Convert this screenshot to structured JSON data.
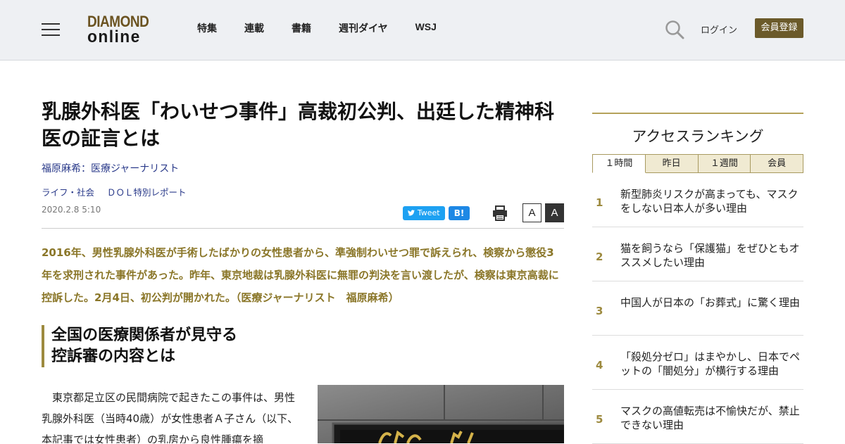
{
  "header": {
    "logo_top": "DIAMOND",
    "logo_bottom": "online",
    "nav": [
      "特集",
      "連載",
      "書籍",
      "週刊ダイヤ",
      "WSJ"
    ],
    "login_label": "ログイン",
    "register_label": "会員登録"
  },
  "article": {
    "title": "乳腺外科医「わいせつ事件」高裁初公判、出廷した精神科医の証言とは",
    "author": "福原麻希：医療ジャーナリスト",
    "categories": [
      "ライフ・社会",
      "ＤＯＬ特別レポート"
    ],
    "date": "2020.2.8 5:10",
    "tweet_label": "Tweet",
    "hatena_label": "B!",
    "font_small": "A",
    "font_large": "A",
    "lead": "2016年、男性乳腺外科医が手術したばかりの女性患者から、準強制わいせつ罪で訴えられ、検察から懲役3年を求刑された事件があった。昨年、東京地裁は乳腺外科医に無罪の判決を言い渡したが、検察は東京高裁に控訴した。2月4日、初公判が開かれた。（医療ジャーナリスト　福原麻希）",
    "subhead_line1": "全国の医療関係者が見守る",
    "subhead_line2": "控訴審の内容とは",
    "body": "東京都足立区の民間病院で起きたこの事件は、男性乳腺外科医（当時40歳）が女性患者Ａ子さん（以下、本記事では女性患者）の乳房から良性腫瘍を摘"
  },
  "ranking": {
    "title": "アクセスランキング",
    "tabs": [
      "１時間",
      "昨日",
      "１週間",
      "会員"
    ],
    "items": [
      {
        "num": "1",
        "text": "新型肺炎リスクが高まっても、マスクをしない日本人が多い理由"
      },
      {
        "num": "2",
        "text": "猫を飼うなら「保護猫」をぜひともオススメしたい理由"
      },
      {
        "num": "3",
        "text": "中国人が日本の「お葬式」に驚く理由"
      },
      {
        "num": "4",
        "text": "「殺処分ゼロ」はまやかし、日本でペットの「闇処分」が横行する理由"
      },
      {
        "num": "5",
        "text": "マスクの高値転売は不愉快だが、禁止できない理由"
      }
    ]
  }
}
